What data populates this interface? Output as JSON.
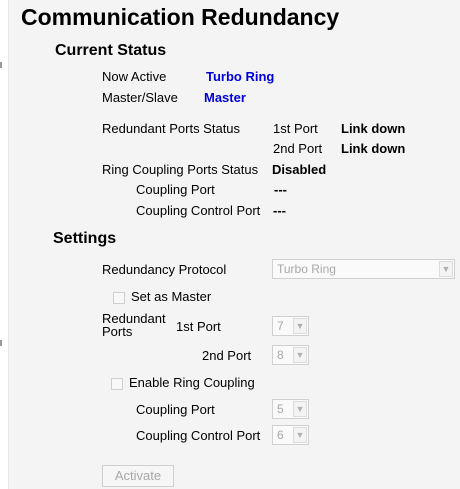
{
  "title": "Communication Redundancy",
  "current_status": {
    "heading": "Current Status",
    "now_active_label": "Now Active",
    "now_active_value": "Turbo Ring",
    "master_slave_label": "Master/Slave",
    "master_slave_value": "Master",
    "redundant_ports_status_label": "Redundant Ports Status",
    "port1_label": "1st Port",
    "port1_value": "Link down",
    "port2_label": "2nd Port",
    "port2_value": "Link down",
    "ring_coupling_status_label": "Ring Coupling Ports Status",
    "ring_coupling_status_value": "Disabled",
    "coupling_port_label": "Coupling Port",
    "coupling_port_value": "---",
    "coupling_control_port_label": "Coupling Control Port",
    "coupling_control_port_value": "---"
  },
  "settings": {
    "heading": "Settings",
    "redundancy_protocol_label": "Redundancy Protocol",
    "redundancy_protocol_value": "Turbo Ring",
    "set_as_master_label": "Set as Master",
    "redundant_ports_label_line1": "Redundant",
    "redundant_ports_label_line2": "Ports",
    "port1_label": "1st Port",
    "port1_value": "7",
    "port2_label": "2nd Port",
    "port2_value": "8",
    "enable_ring_coupling_label": "Enable Ring Coupling",
    "coupling_port_label": "Coupling Port",
    "coupling_port_value": "5",
    "coupling_control_port_label": "Coupling Control Port",
    "coupling_control_port_value": "6",
    "activate_label": "Activate"
  }
}
